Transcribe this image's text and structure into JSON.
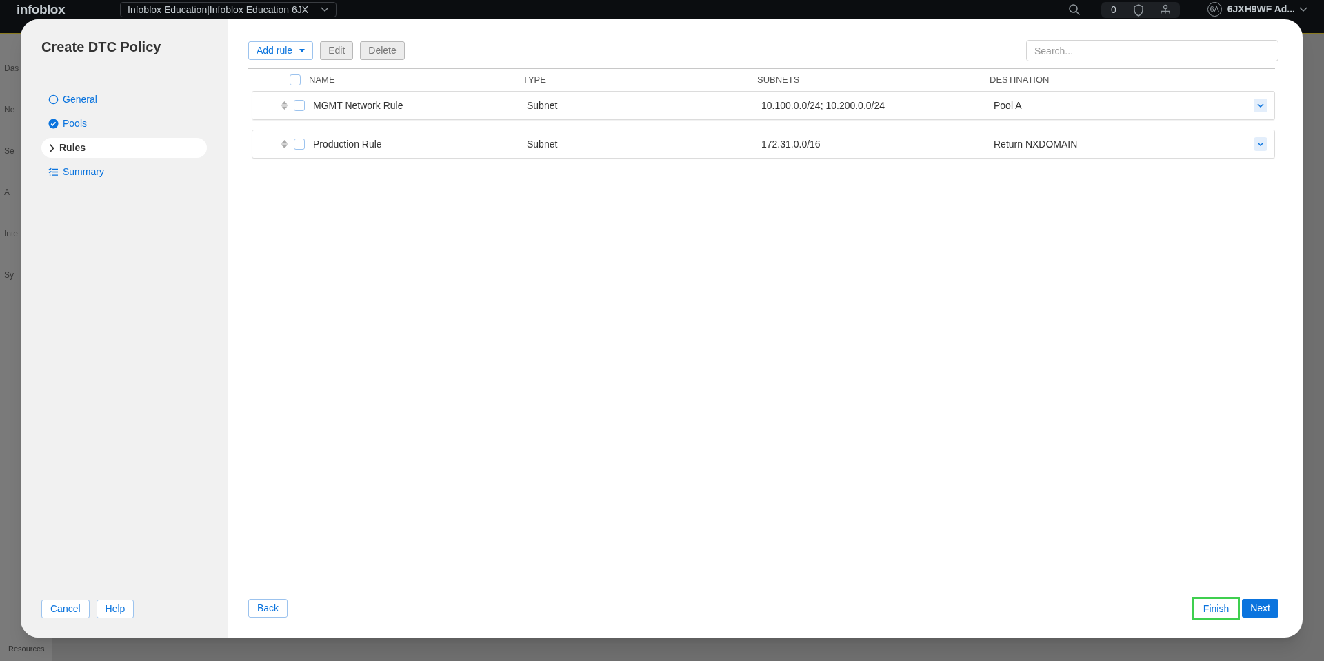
{
  "topbar": {
    "logo": "infoblox",
    "account_selector": "Infoblox Education|Infoblox Education 6JX",
    "count": "0",
    "avatar": "6A",
    "user": "6JXH9WF Ad..."
  },
  "background_nav": [
    "Das",
    "Ne",
    "Se",
    "A",
    "Inte",
    "Sy"
  ],
  "background_footer": "Resources",
  "dialog": {
    "title": "Create DTC Policy",
    "steps": [
      {
        "label": "General",
        "kind": "open",
        "selected": false
      },
      {
        "label": "Pools",
        "kind": "done",
        "selected": false
      },
      {
        "label": "Rules",
        "kind": "current",
        "selected": true
      },
      {
        "label": "Summary",
        "kind": "summary",
        "selected": false
      }
    ],
    "toolbar": {
      "add": "Add rule",
      "edit": "Edit",
      "delete": "Delete",
      "edit_disabled": true,
      "delete_disabled": true
    },
    "search": {
      "placeholder": "Search..."
    },
    "table": {
      "columns": [
        "NAME",
        "TYPE",
        "SUBNETS",
        "DESTINATION"
      ],
      "all_checked": false,
      "rows": [
        {
          "name": "MGMT Network Rule",
          "type": "Subnet",
          "subnets": "10.100.0.0/24; 10.200.0.0/24",
          "destination": "Pool A",
          "checked": false
        },
        {
          "name": "Production Rule",
          "type": "Subnet",
          "subnets": "172.31.0.0/16",
          "destination": "Return NXDOMAIN",
          "checked": false
        }
      ]
    },
    "footer_left": [
      "Cancel",
      "Help"
    ],
    "back": "Back",
    "finish": {
      "label": "Finish",
      "highlighted": true
    },
    "next": "Next"
  }
}
